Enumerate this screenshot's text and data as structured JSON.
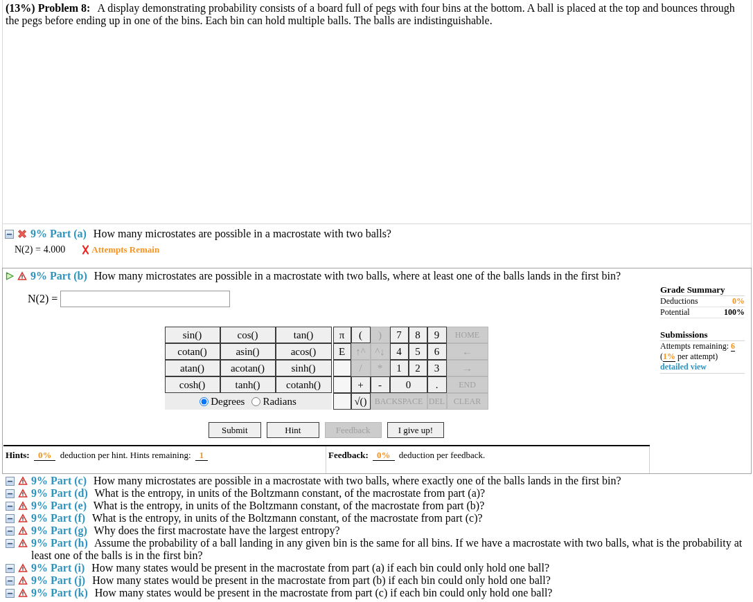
{
  "problem": {
    "heading": "(13%) Problem 8:",
    "statement": "A display demonstrating probability consists of a board full of pegs with four bins at the bottom. A ball is placed at the top and bounces through the pegs before ending up in one of the bins. Each bin can hold multiple balls. The balls are indistinguishable."
  },
  "parts": [
    {
      "label": "9% Part (a)",
      "question": "How many microstates are possible in a macrostate with two balls?",
      "kind": "incorrect",
      "active": false,
      "answer": {
        "prompt": "N(2) =",
        "value": "4.000",
        "correct": false,
        "result": "Attempts Remain"
      }
    },
    {
      "label": "9% Part (b)",
      "question": "How many microstates are possible in a macrostate with two balls, where at least one of the balls lands in the first bin?",
      "kind": "warning",
      "active": true,
      "workspace": {
        "prompt": "N(2) =",
        "functions": [
          "sin()",
          "cos()",
          "tan()",
          "cotan()",
          "asin()",
          "acos()",
          "atan()",
          "acotan()",
          "sinh()",
          "cosh()",
          "tanh()",
          "cotanh()"
        ],
        "angle_modes": [
          {
            "label": "Degrees",
            "selected": true
          },
          {
            "label": "Radians",
            "selected": false
          }
        ],
        "keypad": [
          [
            {
              "kind": "key",
              "label": "π",
              "disabled": false
            },
            {
              "kind": "key",
              "label": "(",
              "disabled": false
            },
            {
              "kind": "key",
              "label": ")",
              "disabled": true
            },
            {
              "kind": "key",
              "label": "7",
              "disabled": false
            },
            {
              "kind": "key",
              "label": "8",
              "disabled": false
            },
            {
              "kind": "key",
              "label": "9",
              "disabled": false
            },
            {
              "kind": "key",
              "label": "HOME",
              "disabled": true
            }
          ],
          [
            {
              "kind": "key",
              "label": "E",
              "disabled": false
            },
            {
              "kind": "key",
              "label": "↑^",
              "disabled": true
            },
            {
              "kind": "key",
              "label": "^↓",
              "disabled": true
            },
            {
              "kind": "key",
              "label": "4",
              "disabled": false
            },
            {
              "kind": "key",
              "label": "5",
              "disabled": false
            },
            {
              "kind": "key",
              "label": "6",
              "disabled": false
            },
            {
              "kind": "key",
              "label": "←",
              "disabled": true
            }
          ],
          [
            {
              "kind": "blank"
            },
            {
              "kind": "key",
              "label": "/",
              "disabled": true
            },
            {
              "kind": "key",
              "label": "*",
              "disabled": true
            },
            {
              "kind": "key",
              "label": "1",
              "disabled": false
            },
            {
              "kind": "key",
              "label": "2",
              "disabled": false
            },
            {
              "kind": "key",
              "label": "3",
              "disabled": false
            },
            {
              "kind": "key",
              "label": "→",
              "disabled": true
            }
          ],
          [
            {
              "kind": "blank"
            },
            {
              "kind": "key",
              "label": "+",
              "disabled": false
            },
            {
              "kind": "key",
              "label": "-",
              "disabled": false
            },
            {
              "kind": "key",
              "label": "0",
              "disabled": false
            },
            {
              "kind": "key",
              "label": ".",
              "disabled": false
            },
            {
              "kind": "key",
              "label": "END",
              "disabled": true
            }
          ],
          [
            {
              "kind": "blank"
            },
            {
              "kind": "key",
              "label": "√()",
              "disabled": false
            },
            {
              "kind": "key",
              "label": "BACKSPACE",
              "disabled": true
            },
            {
              "kind": "key",
              "label": "DEL",
              "disabled": true
            },
            {
              "kind": "key",
              "label": "CLEAR",
              "disabled": true
            }
          ]
        ],
        "buttons": [
          {
            "label": "Submit",
            "disabled": false
          },
          {
            "label": "Hint",
            "disabled": false
          },
          {
            "label": "Feedback",
            "disabled": true
          },
          {
            "label": "I give up!",
            "disabled": false
          }
        ],
        "hints": {
          "label": "Hints:",
          "deduction": "0%",
          "text": "deduction per hint. Hints remaining:",
          "remaining": "1"
        },
        "feedback": {
          "label": "Feedback:",
          "deduction": "0%",
          "text": "deduction per feedback."
        },
        "grade_summary": {
          "title": "Grade Summary",
          "rows": [
            {
              "label": "Deductions",
              "value": "0%",
              "kind": "deduction"
            },
            {
              "label": "Potential",
              "value": "100%",
              "kind": "total"
            }
          ]
        },
        "submissions": {
          "title": "Submissions",
          "attempts_label": "Attempts remaining:",
          "attempts_value": "6",
          "rate_before": "(",
          "rate_value": "1%",
          "rate_after": "per attempt)",
          "link": "detailed view"
        }
      }
    },
    {
      "label": "9% Part (c)",
      "question": "How many microstates are possible in a macrostate with two balls, where exactly one of the balls lands in the first bin?",
      "kind": "warning",
      "active": false
    },
    {
      "label": "9% Part (d)",
      "question": "What is the entropy, in units of the Boltzmann constant, of the macrostate from part (a)?",
      "kind": "warning",
      "active": false
    },
    {
      "label": "9% Part (e)",
      "question": "What is the entropy, in units of the Boltzmann constant, of the macrostate from part (b)?",
      "kind": "warning",
      "active": false
    },
    {
      "label": "9% Part (f)",
      "question": "What is the entropy, in units of the Boltzmann constant, of the macrostate from part (c)?",
      "kind": "warning",
      "active": false
    },
    {
      "label": "9% Part (g)",
      "question": "Why does the first macrostate have the largest entropy?",
      "kind": "warning",
      "active": false
    },
    {
      "label": "9% Part (h)",
      "question": "Assume the probability of a ball landing in any given bin is the same for all bins. If we have a macrostate with two balls, what is the probability at least one of the balls is in the first bin?",
      "kind": "warning",
      "active": false
    },
    {
      "label": "9% Part (i)",
      "question": "How many states would be present in the macrostate from part (a) if each bin could only hold one ball?",
      "kind": "warning",
      "active": false
    },
    {
      "label": "9% Part (j)",
      "question": "How many states would be present in the macrostate from part (b) if each bin could only hold one ball?",
      "kind": "warning",
      "active": false
    },
    {
      "label": "9% Part (k)",
      "question": "How many states would be present in the macrostate from part (c) if each bin could only hold one ball?",
      "kind": "warning",
      "active": false
    }
  ]
}
